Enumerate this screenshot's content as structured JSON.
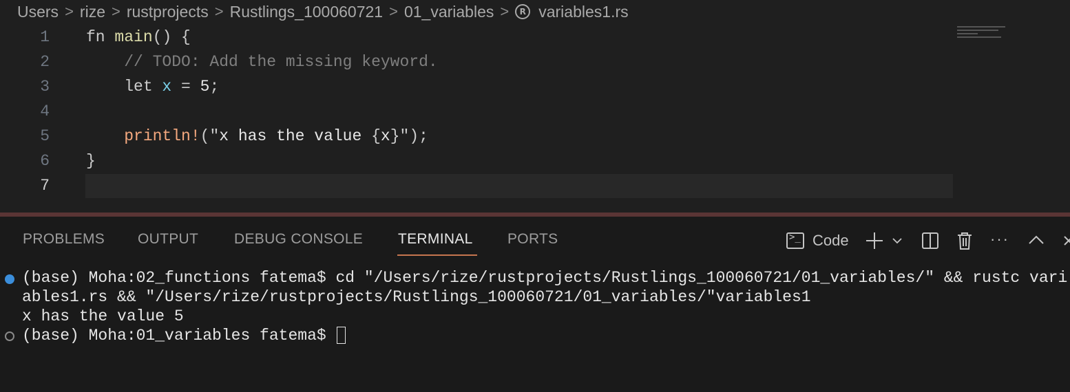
{
  "breadcrumb": {
    "items": [
      "Users",
      "rize",
      "rustprojects",
      "Rustlings_100060721",
      "01_variables"
    ],
    "file": "variables1.rs",
    "file_icon": "rust-file-icon",
    "separator": ">"
  },
  "editor": {
    "line_numbers": [
      "1",
      "2",
      "3",
      "4",
      "5",
      "6",
      "7"
    ],
    "lines": [
      {
        "parts": [
          [
            "kw",
            "fn "
          ],
          [
            "fn",
            "main"
          ],
          [
            "kw",
            "() {"
          ]
        ]
      },
      {
        "parts": [
          [
            "comment",
            "    // TODO: Add the missing keyword."
          ]
        ]
      },
      {
        "parts": [
          [
            "kw",
            "    let "
          ],
          [
            "var",
            "x"
          ],
          [
            "kw",
            " = "
          ],
          [
            "num",
            "5"
          ],
          [
            "kw",
            ";"
          ]
        ]
      },
      {
        "parts": []
      },
      {
        "parts": [
          [
            "macro",
            "    println!"
          ],
          [
            "kw",
            "(\""
          ],
          [
            "str",
            "x has the value "
          ],
          [
            "kw",
            "{"
          ],
          [
            "str",
            "x"
          ],
          [
            "kw",
            "}\");"
          ]
        ]
      },
      {
        "parts": [
          [
            "kw",
            "}"
          ]
        ]
      },
      {
        "parts": []
      }
    ]
  },
  "panel": {
    "tabs": [
      "PROBLEMS",
      "OUTPUT",
      "DEBUG CONSOLE",
      "TERMINAL",
      "PORTS"
    ],
    "active_tab": "TERMINAL",
    "terminal_name": "Code",
    "more_label": "···"
  },
  "terminal": {
    "line1": "(base) Moha:02_functions fatema$ cd \"/Users/rize/rustprojects/Rustlings_100060721/01_variables/\" && rustc vari",
    "line2": "ables1.rs && \"/Users/rize/rustprojects/Rustlings_100060721/01_variables/\"variables1",
    "line3": "x has the value 5",
    "line4": "(base) Moha:01_variables fatema$ "
  },
  "colors": {
    "accent_tab": "#c7764f",
    "status_dot": "#3b8edb"
  }
}
